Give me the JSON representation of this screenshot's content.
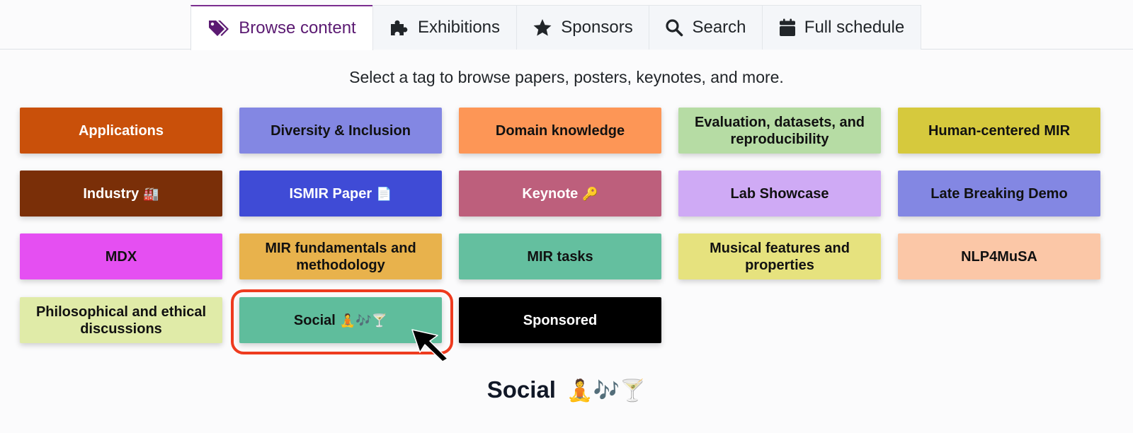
{
  "tabs": [
    {
      "label": "Browse content",
      "icon": "tags-icon"
    },
    {
      "label": "Exhibitions",
      "icon": "puzzle-piece-icon"
    },
    {
      "label": "Sponsors",
      "icon": "star-icon"
    },
    {
      "label": "Search",
      "icon": "search-icon"
    },
    {
      "label": "Full schedule",
      "icon": "calendar-icon"
    }
  ],
  "subtitle": "Select a tag to browse papers, posters, keynotes, and more.",
  "tags": [
    {
      "label": "Applications",
      "emoji": "",
      "bg": "#c9500a",
      "fg": "#ffffff"
    },
    {
      "label": "Diversity & Inclusion",
      "emoji": "",
      "bg": "#8387e3",
      "fg": "#111111"
    },
    {
      "label": "Domain knowledge",
      "emoji": "",
      "bg": "#fd9656",
      "fg": "#111111"
    },
    {
      "label": "Evaluation, datasets, and reproducibility",
      "emoji": "",
      "bg": "#b6dca4",
      "fg": "#111111"
    },
    {
      "label": "Human-centered MIR",
      "emoji": "",
      "bg": "#d6c93d",
      "fg": "#111111"
    },
    {
      "label": "Industry",
      "emoji": "🏭",
      "bg": "#7a2f08",
      "fg": "#ffffff"
    },
    {
      "label": "ISMIR Paper",
      "emoji": "📄",
      "bg": "#3f4bd6",
      "fg": "#ffffff"
    },
    {
      "label": "Keynote",
      "emoji": "🔑",
      "bg": "#bd5f7c",
      "fg": "#ffffff"
    },
    {
      "label": "Lab Showcase",
      "emoji": "",
      "bg": "#cfaaf5",
      "fg": "#111111"
    },
    {
      "label": "Late Breaking Demo",
      "emoji": "",
      "bg": "#8387e3",
      "fg": "#111111"
    },
    {
      "label": "MDX",
      "emoji": "",
      "bg": "#e54ff2",
      "fg": "#111111"
    },
    {
      "label": "MIR fundamentals and methodology",
      "emoji": "",
      "bg": "#e8b24c",
      "fg": "#111111"
    },
    {
      "label": "MIR tasks",
      "emoji": "",
      "bg": "#64bf9f",
      "fg": "#111111"
    },
    {
      "label": "Musical features and properties",
      "emoji": "",
      "bg": "#e6e27e",
      "fg": "#111111"
    },
    {
      "label": "NLP4MuSA",
      "emoji": "",
      "bg": "#fbc7a7",
      "fg": "#111111"
    },
    {
      "label": "Philosophical and ethical discussions",
      "emoji": "",
      "bg": "#e0eba8",
      "fg": "#111111"
    },
    {
      "label": "Social",
      "emoji": "🧘🎶🍸",
      "bg": "#5fbd9c",
      "fg": "#111111"
    },
    {
      "label": "Sponsored",
      "emoji": "",
      "bg": "#000000",
      "fg": "#ffffff"
    }
  ],
  "section": {
    "title": "Social",
    "emoji": "🧘🎶🍸"
  },
  "colors": {
    "accent": "#5b1a72",
    "highlight": "#ee3b1f"
  }
}
